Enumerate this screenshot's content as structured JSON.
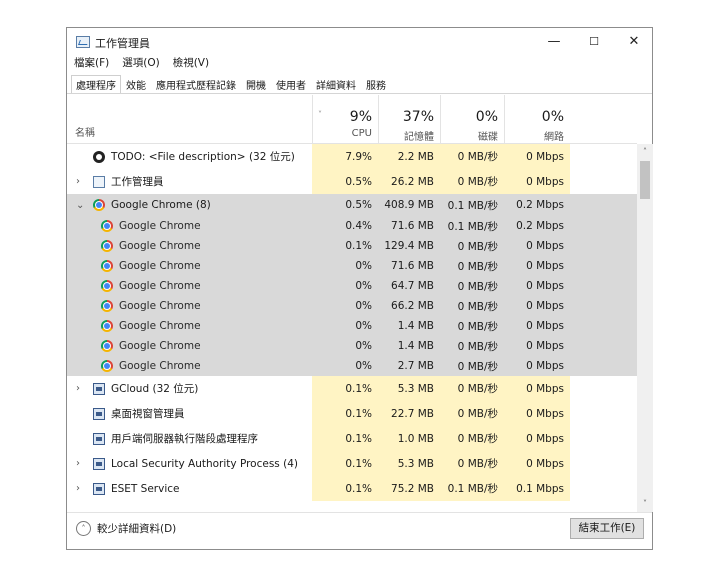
{
  "window": {
    "title": "工作管理員",
    "minimize": "—",
    "maximize": "☐",
    "close": "✕"
  },
  "menu": [
    "檔案(F)",
    "選項(O)",
    "檢視(V)"
  ],
  "tabs": [
    "處理程序",
    "效能",
    "應用程式歷程記錄",
    "開機",
    "使用者",
    "詳細資料",
    "服務"
  ],
  "active_tab": "處理程序",
  "columns": {
    "name": "名稱",
    "cpu": {
      "pct": "9%",
      "label": "CPU"
    },
    "memory": {
      "pct": "37%",
      "label": "記憶體"
    },
    "disk": {
      "pct": "0%",
      "label": "磁碟"
    },
    "network": {
      "pct": "0%",
      "label": "網路"
    }
  },
  "processes": [
    {
      "name": "TODO: <File description> (32 位元)",
      "cpu": "7.9%",
      "mem": "2.2 MB",
      "disk": "0 MB/秒",
      "net": "0 Mbps",
      "icon": "todo-icon"
    },
    {
      "name": "工作管理員",
      "cpu": "0.5%",
      "mem": "26.2 MB",
      "disk": "0 MB/秒",
      "net": "0 Mbps",
      "icon": "task-manager-icon",
      "expand": "›"
    },
    {
      "name": "Google Chrome (8)",
      "cpu": "0.5%",
      "mem": "408.9 MB",
      "disk": "0.1 MB/秒",
      "net": "0.2 Mbps",
      "icon": "chrome-icon",
      "expand": "⌄"
    },
    {
      "name": "Google Chrome",
      "cpu": "0.4%",
      "mem": "71.6 MB",
      "disk": "0.1 MB/秒",
      "net": "0.2 Mbps",
      "icon": "chrome-icon"
    },
    {
      "name": "Google Chrome",
      "cpu": "0.1%",
      "mem": "129.4 MB",
      "disk": "0 MB/秒",
      "net": "0 Mbps",
      "icon": "chrome-icon"
    },
    {
      "name": "Google Chrome",
      "cpu": "0%",
      "mem": "71.6 MB",
      "disk": "0 MB/秒",
      "net": "0 Mbps",
      "icon": "chrome-icon"
    },
    {
      "name": "Google Chrome",
      "cpu": "0%",
      "mem": "64.7 MB",
      "disk": "0 MB/秒",
      "net": "0 Mbps",
      "icon": "chrome-icon"
    },
    {
      "name": "Google Chrome",
      "cpu": "0%",
      "mem": "66.2 MB",
      "disk": "0 MB/秒",
      "net": "0 Mbps",
      "icon": "chrome-icon"
    },
    {
      "name": "Google Chrome",
      "cpu": "0%",
      "mem": "1.4 MB",
      "disk": "0 MB/秒",
      "net": "0 Mbps",
      "icon": "chrome-icon"
    },
    {
      "name": "Google Chrome",
      "cpu": "0%",
      "mem": "1.4 MB",
      "disk": "0 MB/秒",
      "net": "0 Mbps",
      "icon": "chrome-icon"
    },
    {
      "name": "Google Chrome",
      "cpu": "0%",
      "mem": "2.7 MB",
      "disk": "0 MB/秒",
      "net": "0 Mbps",
      "icon": "chrome-icon"
    },
    {
      "name": "GCloud (32 位元)",
      "cpu": "0.1%",
      "mem": "5.3 MB",
      "disk": "0 MB/秒",
      "net": "0 Mbps",
      "icon": "service-icon",
      "expand": "›"
    },
    {
      "name": "桌面視窗管理員",
      "cpu": "0.1%",
      "mem": "22.7 MB",
      "disk": "0 MB/秒",
      "net": "0 Mbps",
      "icon": "service-icon"
    },
    {
      "name": "用戶端伺服器執行階段處理程序",
      "cpu": "0.1%",
      "mem": "1.0 MB",
      "disk": "0 MB/秒",
      "net": "0 Mbps",
      "icon": "service-icon"
    },
    {
      "name": "Local Security Authority Process (4)",
      "cpu": "0.1%",
      "mem": "5.3 MB",
      "disk": "0 MB/秒",
      "net": "0 Mbps",
      "icon": "service-icon",
      "expand": "›"
    },
    {
      "name": "ESET Service",
      "cpu": "0.1%",
      "mem": "75.2 MB",
      "disk": "0.1 MB/秒",
      "net": "0.1 Mbps",
      "icon": "service-icon",
      "expand": "›"
    }
  ],
  "scroll_up": "˄",
  "scroll_down": "˅",
  "sort_indicator": "˅",
  "footer": {
    "fewer_details": "較少詳細資料(D)",
    "fewer_icon": "˄",
    "end_task": "結束工作(E)"
  }
}
